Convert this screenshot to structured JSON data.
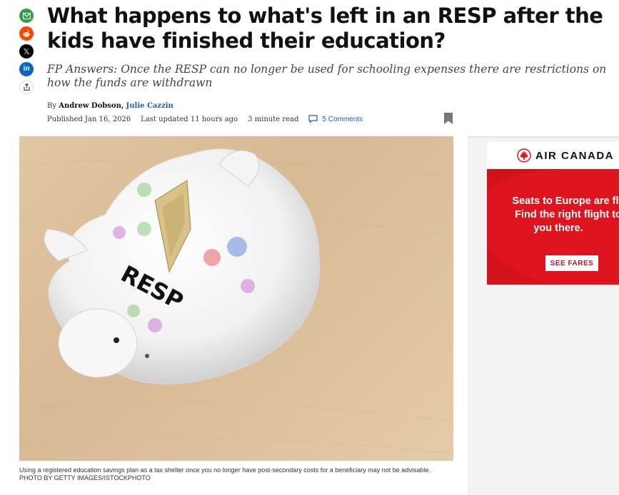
{
  "article": {
    "headline": "What happens to what's left in an RESP after the kids have finished their education?",
    "deck": "FP Answers: Once the RESP can no longer be used for schooling expenses there are restrictions on how the funds are withdrawn",
    "byline_prefix": "By",
    "author1": "Andrew Dobson,",
    "author2": "Julie Cazzin",
    "published": "Published Jan 16, 2026",
    "updated": "Last updated 11 hours ago",
    "read_time": "3 minute read",
    "comments": "5 Comments",
    "image_label": "RESP",
    "caption": "Using a registered education savings plan as a tax shelter once you no longer have post-secondary costs for a beneficiary may not be advisable. PHOTO BY GETTY IMAGES/ISTOCKPHOTO"
  },
  "share": {
    "icons": [
      "email-icon",
      "reddit-icon",
      "x-icon",
      "linkedin-icon",
      "share-icon"
    ],
    "x_glyph": "𝕏",
    "linkedin_glyph": "in"
  },
  "ad": {
    "brand": "AIR CANADA",
    "line1": "Seats to Europe are fly",
    "line2": "Find the right flight to",
    "line3": "you there.",
    "cta": "SEE FARES"
  },
  "colors": {
    "link": "#1e5bb8",
    "ad_red": "#e0141e",
    "email_green": "#2e9e47",
    "reddit_orange": "#ff4500",
    "linkedin_blue": "#0a66c2"
  }
}
